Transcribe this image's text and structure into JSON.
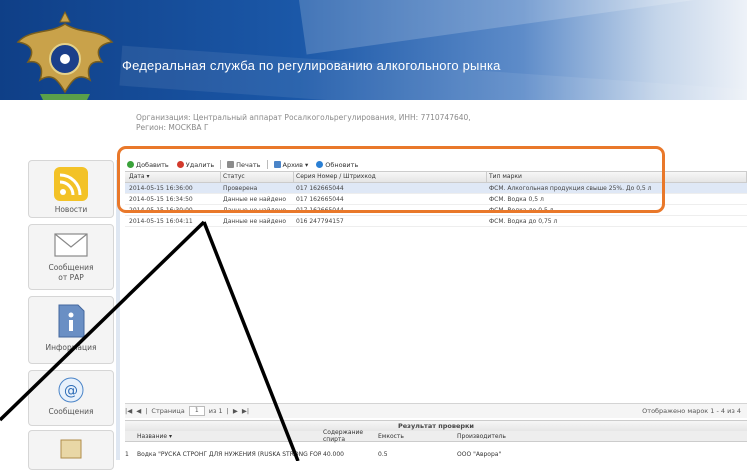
{
  "header": {
    "title": "Федеральная служба по регулированию алкогольного рынка",
    "emblem_icon": "double-headed-eagle-emblem"
  },
  "org": {
    "line1": "Организация: Центральный аппарат Росалкогольрегулирования, ИНН: 7710747640,",
    "line2": "Регион: МОСКВА Г"
  },
  "nav": {
    "news": {
      "label": "Новости",
      "icon": "rss-icon"
    },
    "messages_rar": {
      "label1": "Сообщения",
      "label2": "от РАР",
      "icon": "envelope-icon"
    },
    "info": {
      "label": "Информация",
      "icon": "info-icon"
    },
    "messages": {
      "label": "Сообщения",
      "icon": "at-icon"
    }
  },
  "toolbar": {
    "add": "Добавить",
    "delete": "Удалить",
    "print": "Печать",
    "archive": "Архив",
    "refresh": "Обновить"
  },
  "grid": {
    "headers": [
      "Дата",
      "Статус",
      "Серия Номер / Штрихкод",
      "Тип марки"
    ],
    "rows": [
      [
        "2014-05-15 16:36:00",
        "Проверена",
        "017 162665044",
        "ФСМ. Алкогольная продукция свыше 25%. До 0,5 л"
      ],
      [
        "2014-05-15 16:34:50",
        "Данные не найдено",
        "017 162665044",
        "ФСМ. Водка 0,5 л"
      ],
      [
        "2014-05-15 16:30:00",
        "Данные не найдено",
        "017 162665044",
        "ФСМ. Водка до 0,5 л"
      ],
      [
        "2014-05-15 16:04:11",
        "Данные не найдено",
        "016 247794157",
        "ФСМ. Водка до 0,75 л"
      ]
    ]
  },
  "pager": {
    "page_label": "Страница",
    "page_value": "1",
    "of_label": "из 1",
    "info": "Отображено марок 1 - 4 из 4"
  },
  "result": {
    "title": "Результат проверки",
    "headers": [
      "Название",
      "Содержание спирта",
      "Емкость",
      "Производитель"
    ],
    "row": [
      "Водка \"РУСКА СТРОНГ ДЛЯ НУЖЕНИЯ (RUSKA STRONG FOR MEN)\"",
      "40.000",
      "0.5",
      "ООО \"Аврора\""
    ]
  },
  "colors": {
    "accent_orange": "#e9782a",
    "banner_blue": "#1b58a8"
  }
}
